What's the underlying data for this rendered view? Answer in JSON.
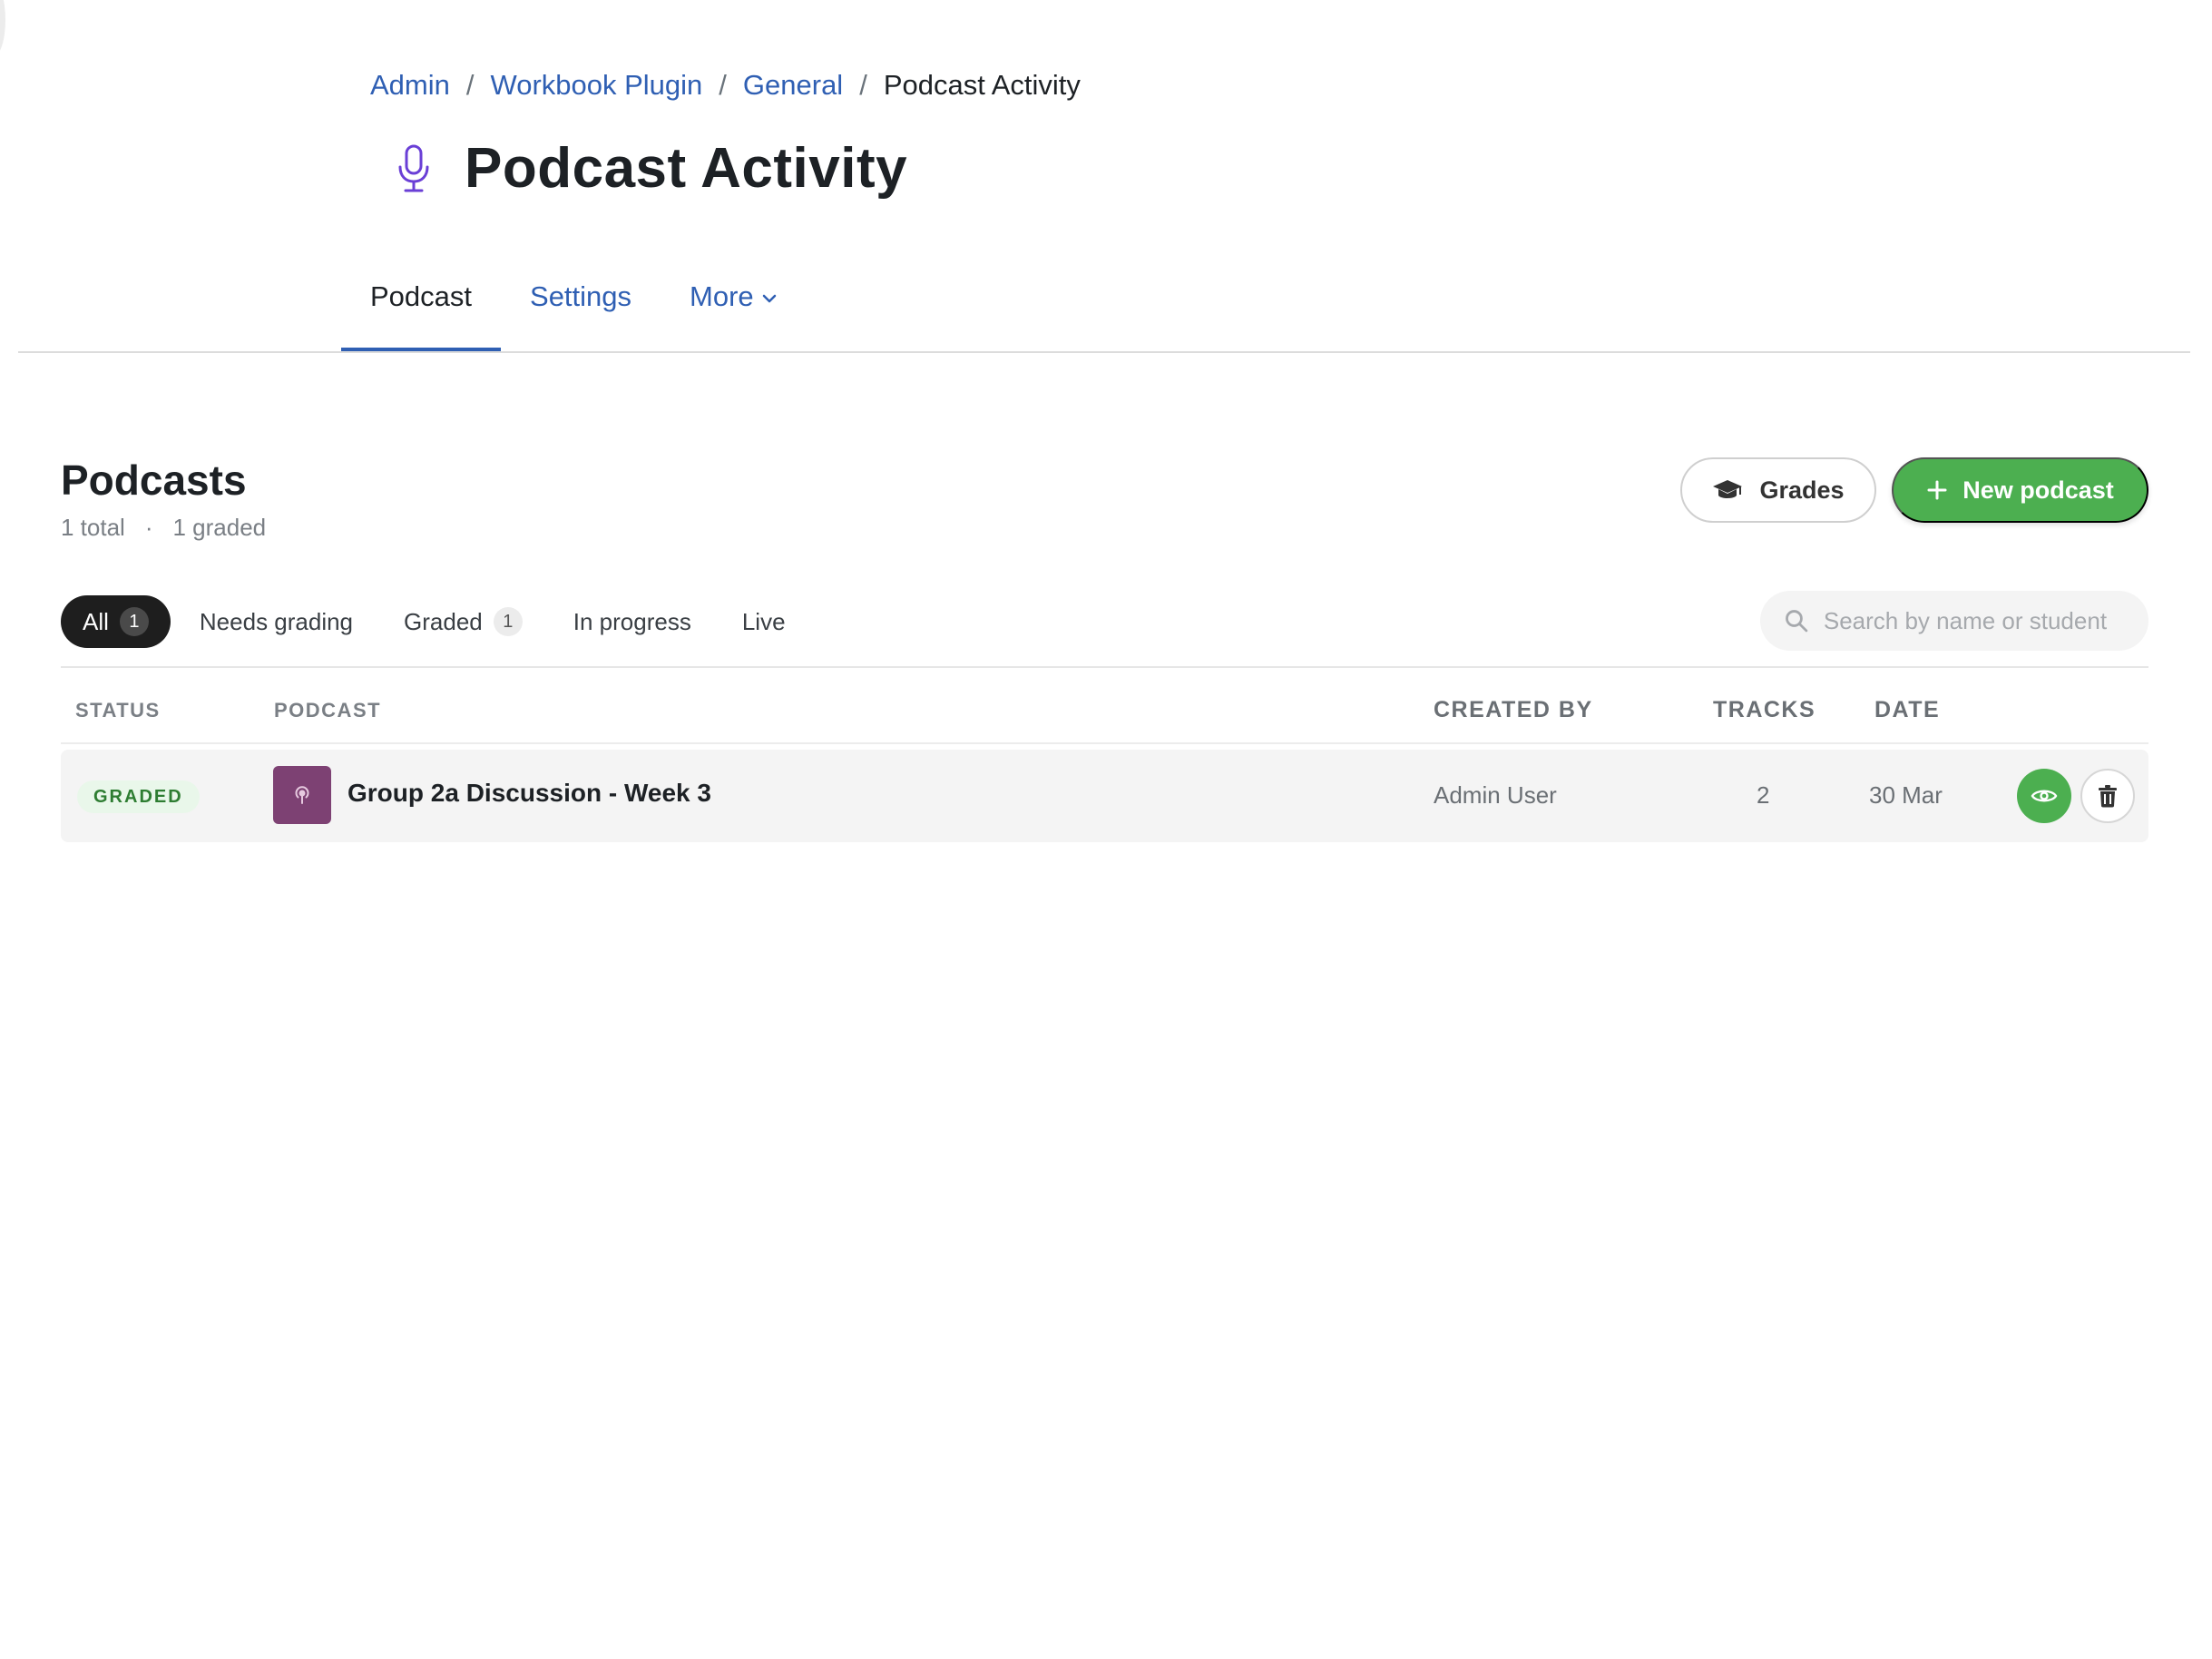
{
  "breadcrumb": {
    "items": [
      "Admin",
      "Workbook Plugin",
      "General"
    ],
    "separator": "/",
    "current": "Podcast Activity"
  },
  "page": {
    "title": "Podcast Activity",
    "icon": "microphone-icon"
  },
  "tabs": [
    {
      "label": "Podcast",
      "active": true
    },
    {
      "label": "Settings",
      "active": false
    },
    {
      "label": "More",
      "active": false
    }
  ],
  "section": {
    "title": "Podcasts",
    "total": "1 total",
    "dot": "·",
    "graded": "1 graded"
  },
  "actions": {
    "grades_label": "Grades",
    "new_label": "New podcast"
  },
  "filters": [
    {
      "label": "All",
      "count": "1",
      "active": true
    },
    {
      "label": "Needs grading",
      "count": null,
      "active": false
    },
    {
      "label": "Graded",
      "count": "1",
      "active": false
    },
    {
      "label": "In progress",
      "count": null,
      "active": false
    },
    {
      "label": "Live",
      "count": null,
      "active": false
    }
  ],
  "search": {
    "placeholder": "Search by name or student",
    "value": ""
  },
  "table": {
    "headers": {
      "status": "STATUS",
      "podcast": "PODCAST",
      "created_by": "CREATED BY",
      "tracks": "TRACKS",
      "date": "DATE"
    },
    "rows": [
      {
        "status": "GRADED",
        "name": "Group 2a Discussion - Week 3",
        "created_by": "Admin User",
        "tracks": "2",
        "date": "30 Mar"
      }
    ]
  },
  "colors": {
    "accent_blue": "#2f5fb3",
    "green": "#4caf50",
    "mic_purple": "#6a3fd6",
    "thumb_purple": "#7d4173"
  }
}
